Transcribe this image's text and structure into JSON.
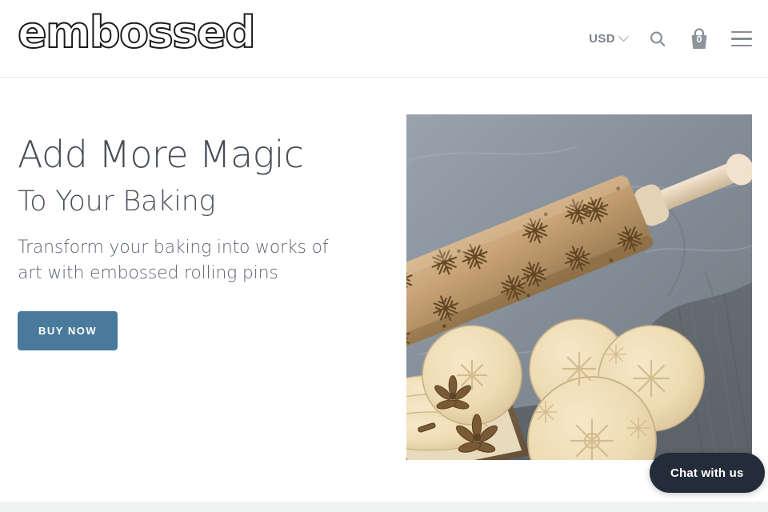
{
  "header": {
    "logo_text": "embossed",
    "currency": {
      "label": "USD",
      "chevron_icon": "chevron-down-icon"
    },
    "search_icon": "search-icon",
    "cart": {
      "icon": "shopping-basket-icon",
      "count": "0"
    },
    "menu_icon": "hamburger-menu-icon"
  },
  "hero": {
    "headline": "Add More Magic",
    "subheadline": "To Your Baking",
    "paragraph": "Transform your baking into works of art with embossed rolling pins",
    "cta_label": "BUY NOW",
    "image_alt": "Embossed wooden rolling pin with snowflake pattern on gray linen beside snowflake-embossed cookies, star anise and a metal tin on weathered wood"
  },
  "chat": {
    "label": "Chat with us"
  },
  "colors": {
    "accent_button": "#4a7a9b",
    "headline_text": "#464d55",
    "body_text": "#5e6771",
    "icon_gray": "#868d95",
    "chat_bg": "#242c39",
    "footer_strip": "#f0f1f1",
    "header_border": "#e9e9e9"
  }
}
